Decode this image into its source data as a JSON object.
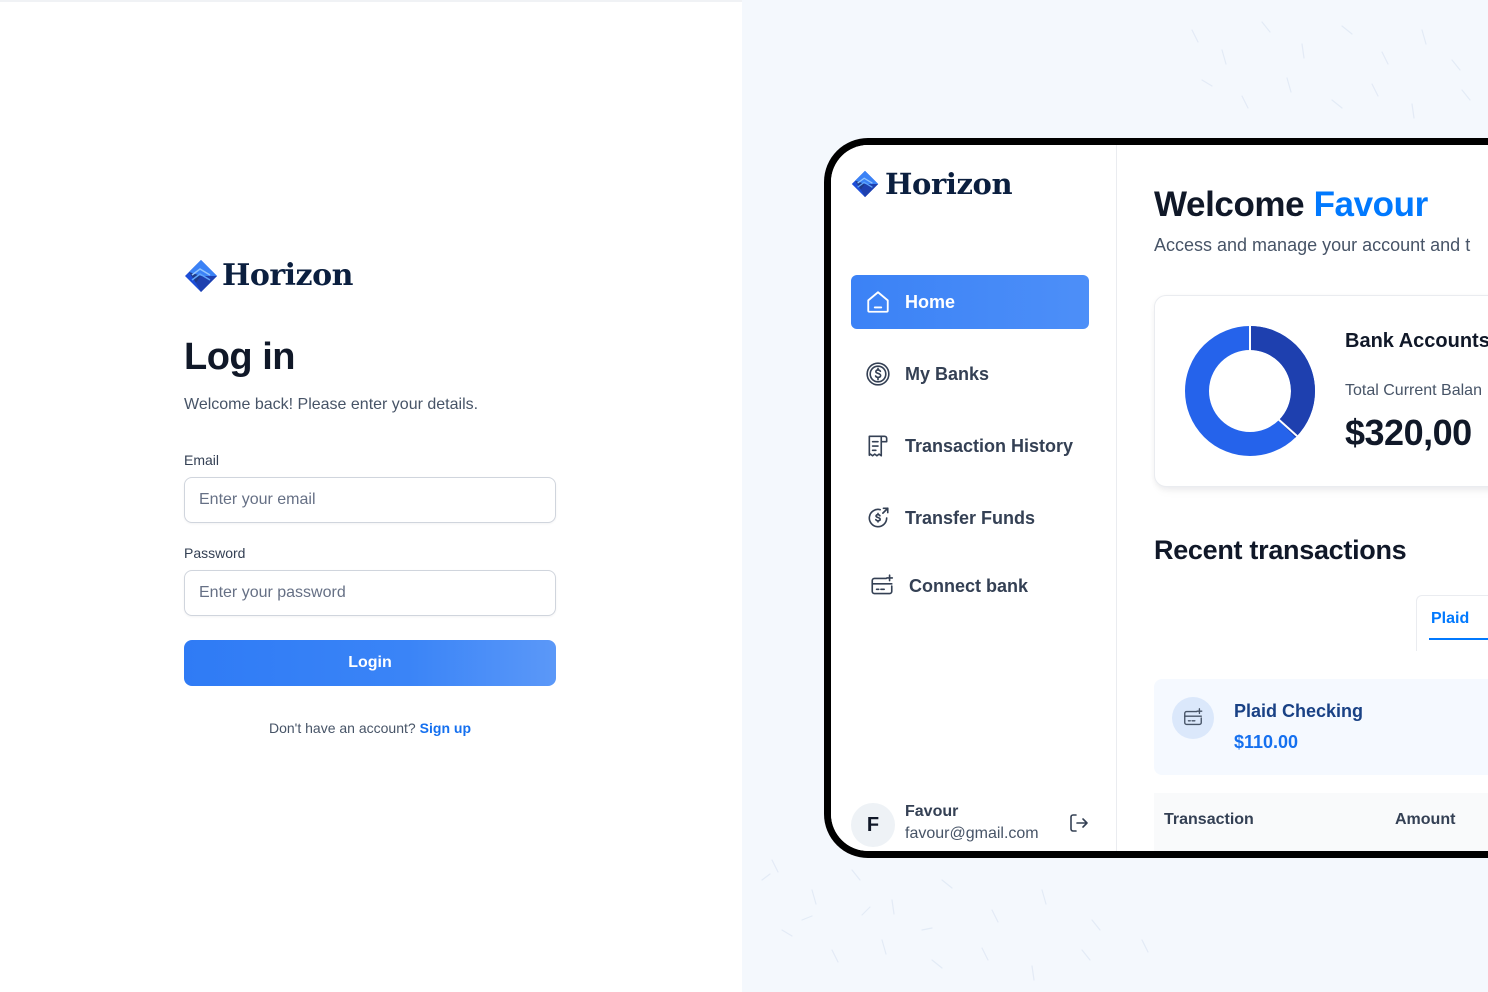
{
  "login": {
    "brand": "Horizon",
    "title": "Log in",
    "subtitle": "Welcome back! Please enter your details.",
    "email_label": "Email",
    "email_placeholder": "Enter your email",
    "password_label": "Password",
    "password_placeholder": "Enter your password",
    "login_button": "Login",
    "signup_prompt": "Don't have an account?",
    "signup_link": "Sign up"
  },
  "preview": {
    "brand": "Horizon",
    "nav": [
      {
        "label": "Home",
        "icon": "home-icon",
        "active": true
      },
      {
        "label": "My Banks",
        "icon": "dollar-circle-icon",
        "active": false
      },
      {
        "label": "Transaction History",
        "icon": "receipt-icon",
        "active": false
      },
      {
        "label": "Transfer Funds",
        "icon": "money-send-icon",
        "active": false
      },
      {
        "label": "Connect bank",
        "icon": "card-add-icon",
        "active": false
      }
    ],
    "user": {
      "initial": "F",
      "name": "Favour",
      "email": "favour@gmail.com"
    },
    "welcome_prefix": "Welcome",
    "welcome_name": "Favour",
    "welcome_sub": "Access and manage your account and t",
    "bank_card": {
      "title": "Bank Accounts",
      "balance_label": "Total Current Balan",
      "balance_value": "$320,00"
    },
    "recent_title": "Recent transactions",
    "tab_label": "Plaid",
    "account": {
      "name": "Plaid Checking",
      "balance": "$110.00"
    },
    "table_headers": [
      "Transaction",
      "Amount"
    ]
  },
  "colors": {
    "accent": "#3b82f6",
    "link": "#1570ef",
    "brand_navy": "#0b1f3f",
    "highlight": "#0179fe",
    "panel_bg": "#f4f8fd"
  }
}
